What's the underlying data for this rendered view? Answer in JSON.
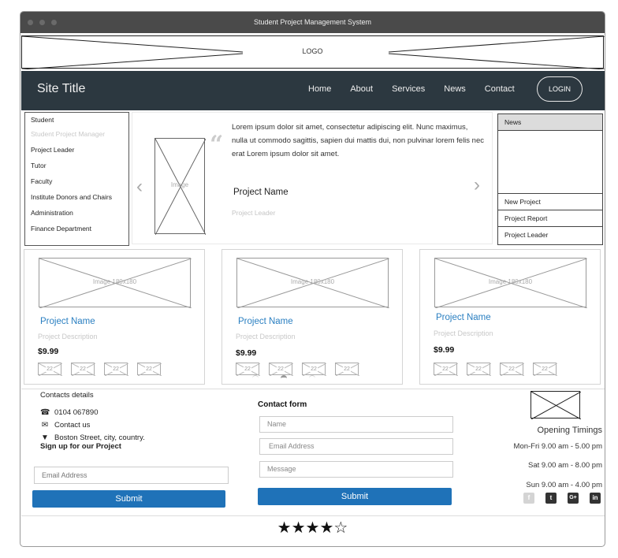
{
  "window": {
    "title": "Student Project Management System"
  },
  "logo": {
    "text": "LOGO"
  },
  "navbar": {
    "site_title": "Site Title",
    "links": [
      "Home",
      "About",
      "Services",
      "News",
      "Contact"
    ],
    "login_label": "LOGIN"
  },
  "sidebar": {
    "items": [
      {
        "label": "Student",
        "muted": false
      },
      {
        "label": "Student Project Manager",
        "muted": true
      },
      {
        "label": "Project Leader",
        "muted": false
      },
      {
        "label": "Tutor",
        "muted": false
      },
      {
        "label": "Faculty",
        "muted": false
      },
      {
        "label": "Institute Donors and Chairs",
        "muted": false
      },
      {
        "label": "Administration",
        "muted": false
      },
      {
        "label": "Finance Department",
        "muted": false
      }
    ]
  },
  "carousel": {
    "prev_icon": "chevron-left",
    "next_icon": "chevron-right",
    "image_label": "Image",
    "quote_icon": "quote-open",
    "text": "Lorem ipsum dolor sit amet, consectetur adipiscing elit. Nunc maximus, nulla ut commodo sagittis, sapien dui mattis dui, non pulvinar lorem felis nec erat Lorem ipsum dolor sit amet.",
    "project_name": "Project Name",
    "project_leader": "Project Leader",
    "pages": 3,
    "active_page": 2
  },
  "news": {
    "title": "News",
    "items": [
      "New Project",
      "Project Report",
      "Project Leader"
    ]
  },
  "cards": [
    {
      "image_label": "Image 180x180",
      "name": "Project Name",
      "description": "Project Description",
      "price": "$9.99",
      "thumbs": [
        "22",
        "22",
        "22",
        "22"
      ]
    },
    {
      "image_label": "Image 180x180",
      "name": "Project Name",
      "description": "Project Description",
      "price": "$9.99",
      "thumbs": [
        "22",
        "22",
        "22",
        "22"
      ]
    },
    {
      "image_label": "Image 180x180",
      "name": "Project Name",
      "description": "Project Description",
      "price": "$9.99",
      "thumbs": [
        "22",
        "22",
        "22",
        "22"
      ]
    }
  ],
  "contacts": {
    "title": "Contacts details",
    "phone": "0104 067890",
    "email_link": "Contact us",
    "address": "Boston Street, city, country.",
    "signup_title": "Sign up for our Project",
    "email_placeholder": "Email Address",
    "submit_label": "Submit"
  },
  "contact_form": {
    "title": "Contact form",
    "name_placeholder": "Name",
    "email_placeholder": "Email Address",
    "message_placeholder": "Message",
    "submit_label": "Submit"
  },
  "timings": {
    "title": "Opening Timings",
    "lines": [
      "Mon-Fri 9.00 am - 5.00 pm",
      "Sat 9.00 am - 8.00 pm",
      "Sun 9.00 am - 4.00 pm"
    ]
  },
  "socials": [
    {
      "name": "facebook",
      "glyph": "f"
    },
    {
      "name": "twitter",
      "glyph": "t"
    },
    {
      "name": "google-plus",
      "glyph": "G+"
    },
    {
      "name": "linkedin",
      "glyph": "in"
    }
  ],
  "rating": {
    "value": 4,
    "max": 5,
    "filled": "★",
    "empty": "☆"
  },
  "colors": {
    "navbar": "#2c3840",
    "accent": "#1f72b8",
    "link": "#2a7fc1",
    "titlebar": "#4a4a4a"
  }
}
